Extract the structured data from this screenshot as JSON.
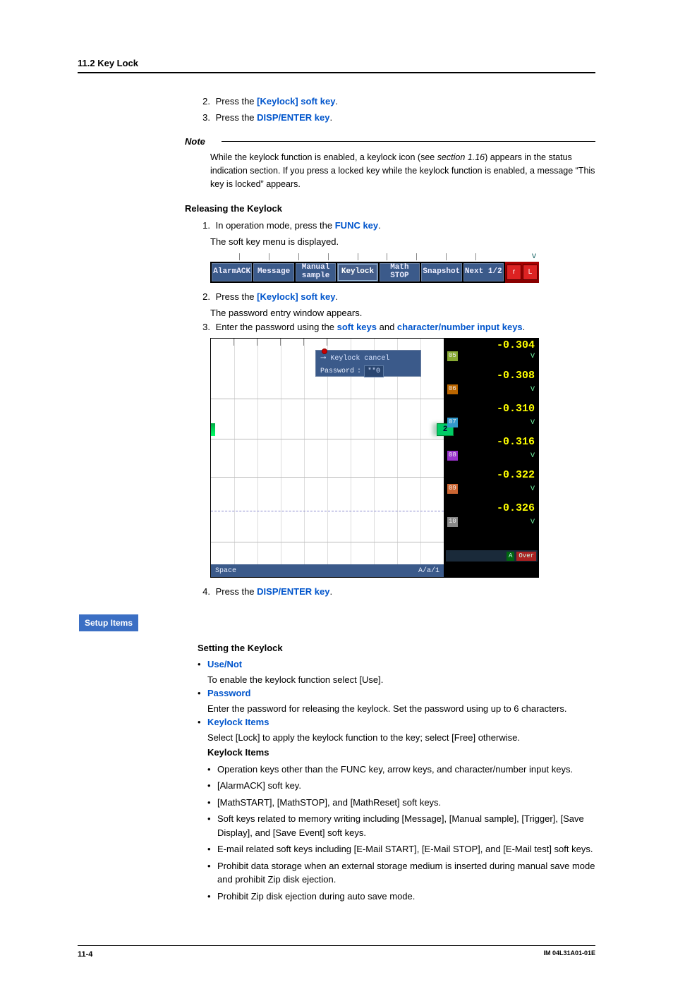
{
  "header": {
    "section": "11.2  Key Lock"
  },
  "top_steps": [
    {
      "n": "2.",
      "pre": "Press the ",
      "key": "[Keylock] soft key",
      "post": "."
    },
    {
      "n": "3.",
      "pre": "Press the ",
      "key": "DISP/ENTER key",
      "post": "."
    }
  ],
  "note": {
    "title": "Note",
    "body_a": "While the keylock function is enabled, a keylock icon (see ",
    "body_ref": "section 1.16",
    "body_b": ") appears in the status indication section.  If you press a locked key while the keylock function is enabled, a message “This key is locked” appears."
  },
  "releasing": {
    "title": "Releasing the Keylock",
    "s1_a": "In operation mode, press the ",
    "s1_key": "FUNC key",
    "s1_b": ".",
    "s1_sub": "The soft key menu is displayed.",
    "s2_a": "Press the ",
    "s2_key": "[Keylock] soft key",
    "s2_b": ".",
    "s2_sub": "The password entry window appears.",
    "s3_a": "Enter the password using the ",
    "s3_key1": "soft keys",
    "s3_mid": " and ",
    "s3_key2": "character/number input keys",
    "s3_b": ".",
    "s4_a": "Press the ",
    "s4_key": "DISP/ENTER key",
    "s4_b": "."
  },
  "softkeys": {
    "b1": "AlarmACK",
    "b2": "Message",
    "b3a": "Manual",
    "b3b": "sample",
    "b4": "Keylock",
    "b5a": "Math",
    "b5b": "STOP",
    "b6": "Snapshot",
    "b7": "Next 1/2",
    "tr": "V",
    "ind1": "r",
    "ind2": "L"
  },
  "pw": {
    "dlg_title": "Keylock cancel",
    "dlg_label": "Password",
    "dlg_val": "**0",
    "marker": "2",
    "bottom_l": "Space",
    "bottom_r": "A/a/1",
    "rtop": "-0.304",
    "ch": [
      {
        "tag": "05",
        "tagc": "t5",
        "unit": "V",
        "val": "-0.308"
      },
      {
        "tag": "06",
        "tagc": "t6",
        "unit": "V",
        "val": "-0.310"
      },
      {
        "tag": "07",
        "tagc": "t7",
        "unit": "V",
        "val": "-0.316"
      },
      {
        "tag": "08",
        "tagc": "t8",
        "unit": "V",
        "val": "-0.322"
      },
      {
        "tag": "09",
        "tagc": "t9",
        "unit": "V",
        "val": "-0.326"
      },
      {
        "tag": "10",
        "tagc": "t10",
        "unit": "V",
        "val": ""
      }
    ],
    "rb_a": "A",
    "rb_ov": "Over"
  },
  "setup": {
    "tag": "Setup Items",
    "title": "Setting the Keylock",
    "items": [
      {
        "name": "Use/Not",
        "desc": "To enable the keylock function select [Use]."
      },
      {
        "name": "Password",
        "desc": "Enter the password for releasing the keylock.  Set the password using up to 6 characters."
      },
      {
        "name": "Keylock Items",
        "desc": "Select [Lock] to apply the keylock function to the key; select [Free] otherwise."
      }
    ],
    "kl_title": "Keylock Items",
    "kl": [
      "Operation keys other than the FUNC key, arrow keys, and character/number input keys.",
      "[AlarmACK] soft key.",
      "[MathSTART], [MathSTOP], and [MathReset] soft keys.",
      "Soft keys related to memory writing including [Message], [Manual sample], [Trigger], [Save Display], and [Save Event] soft keys.",
      "E-mail related soft keys including [E-Mail START], [E-Mail STOP], and [E-Mail test] soft keys.",
      "Prohibit data storage when an external storage medium is inserted during manual save mode and prohibit Zip disk ejection.",
      "Prohibit Zip disk ejection during auto save mode."
    ]
  },
  "footer": {
    "page": "11-4",
    "doc": "IM 04L31A01-01E"
  }
}
